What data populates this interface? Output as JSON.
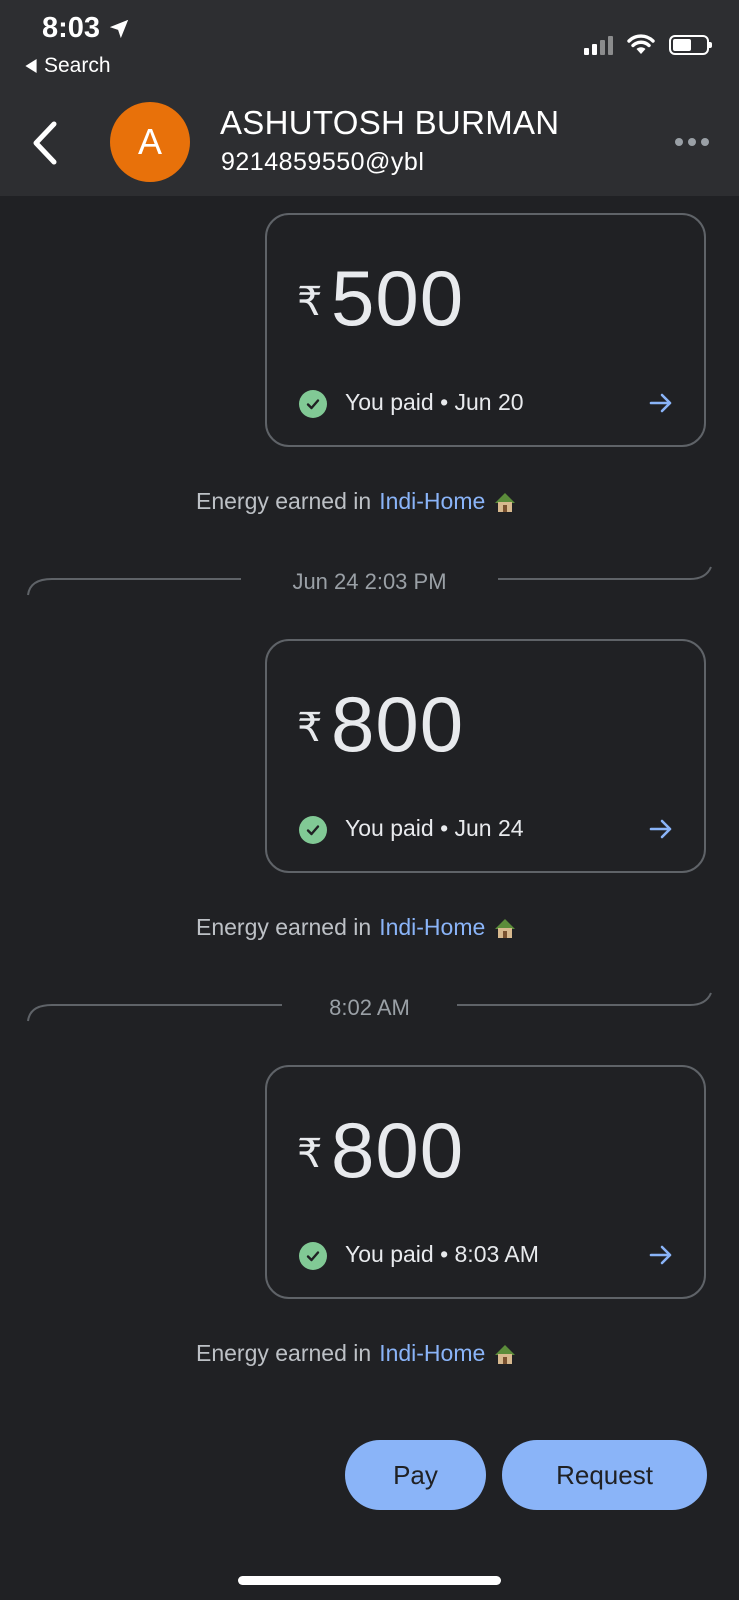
{
  "status_bar": {
    "time": "8:03",
    "back_app": "Search"
  },
  "header": {
    "avatar_letter": "A",
    "name": "ASHUTOSH BURMAN",
    "upi_id": "9214859550@ybl"
  },
  "messages": [
    {
      "currency": "₹",
      "amount": "500",
      "status": "You paid • Jun 20",
      "energy_prefix": "Energy earned in",
      "energy_link": "Indi-Home"
    },
    {
      "currency": "₹",
      "amount": "800",
      "status": "You paid • Jun 24",
      "energy_prefix": "Energy earned in",
      "energy_link": "Indi-Home"
    },
    {
      "currency": "₹",
      "amount": "800",
      "status": "You paid • 8:03 AM",
      "energy_prefix": "Energy earned in",
      "energy_link": "Indi-Home"
    }
  ],
  "dividers": [
    "Jun 24 2:03 PM",
    "8:02 AM"
  ],
  "actions": {
    "pay": "Pay",
    "request": "Request"
  },
  "colors": {
    "background": "#202124",
    "header": "#2d2e31",
    "accent": "#8ab4f8",
    "success": "#81c995",
    "avatar": "#e8710a"
  }
}
